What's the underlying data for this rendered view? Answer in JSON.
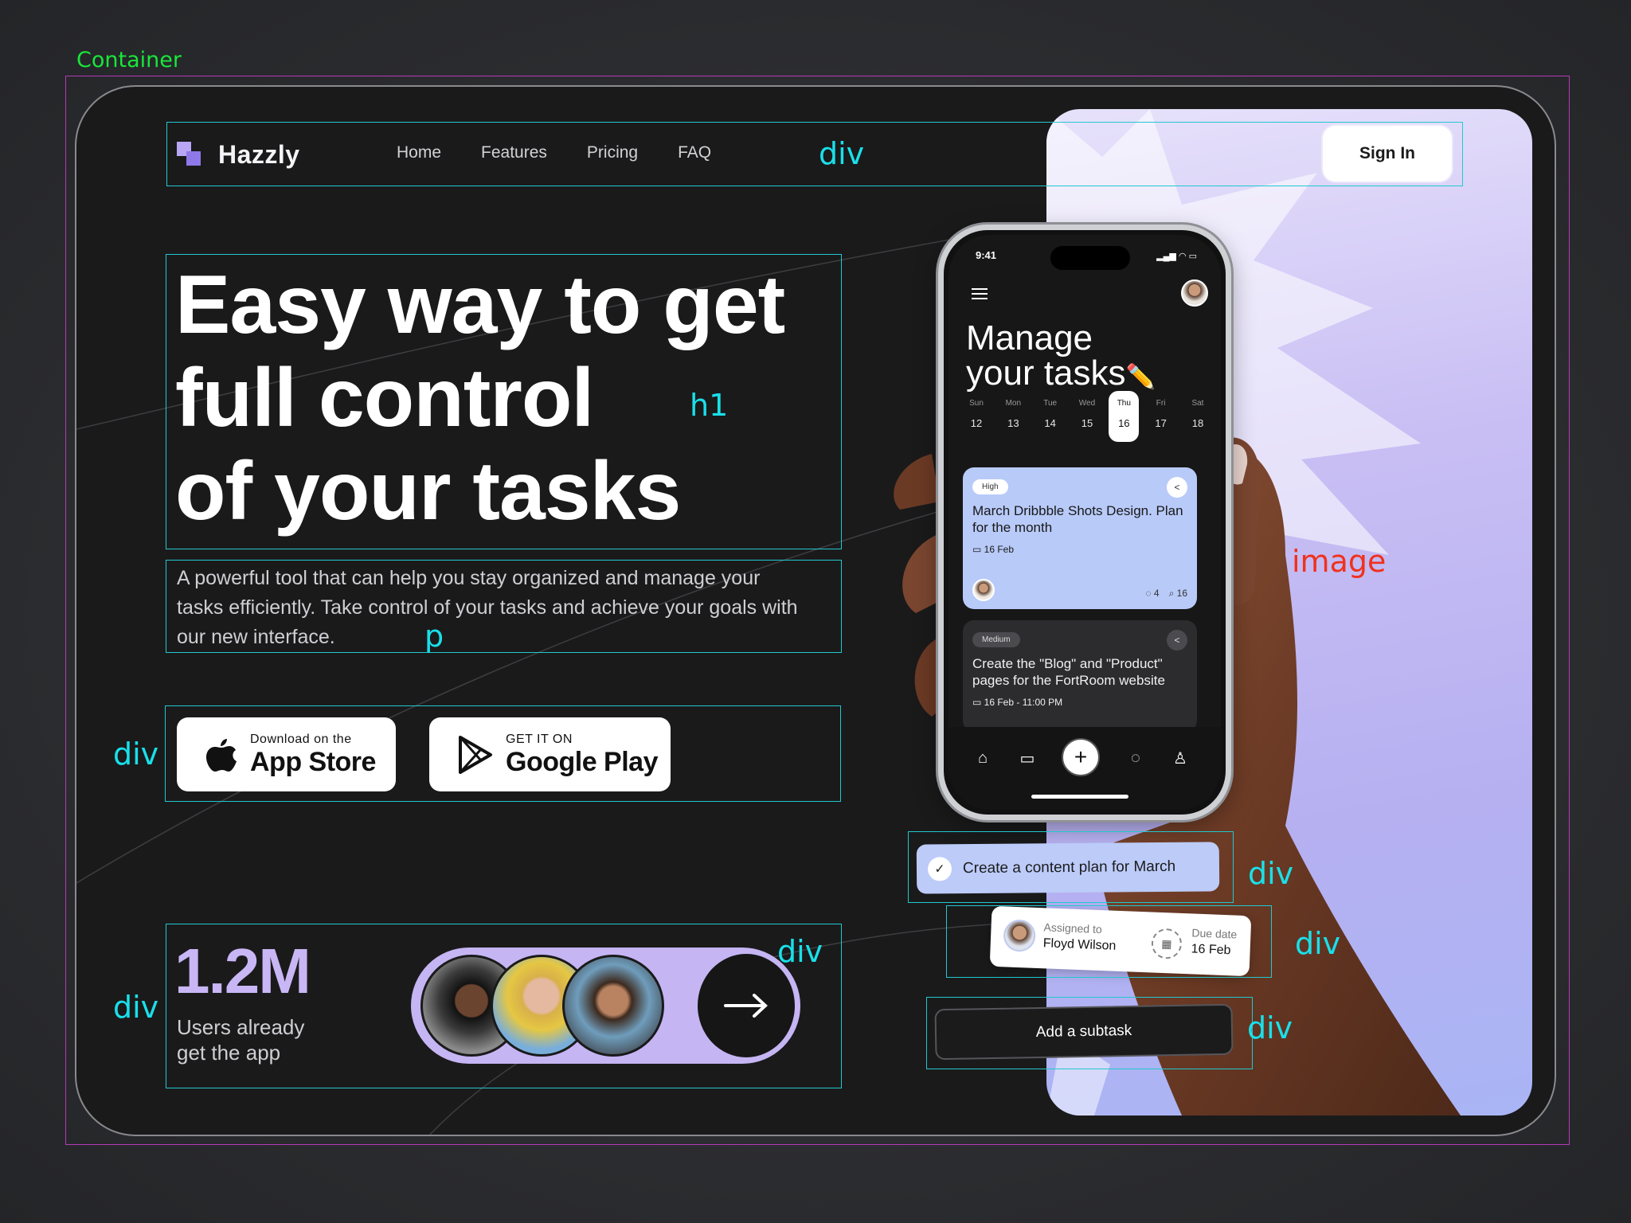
{
  "annotations": {
    "container": "Container",
    "nav_div": "div",
    "h1": "h1",
    "p": "p",
    "buttons_div": "div",
    "stats_div": "div",
    "stats_inner_div": "div",
    "image": "image",
    "content_plan_div": "div",
    "assign_div": "div",
    "subtask_div": "div"
  },
  "brand": {
    "name": "Hazzly"
  },
  "nav": {
    "links": [
      "Home",
      "Features",
      "Pricing",
      "FAQ"
    ],
    "signin": "Sign In"
  },
  "hero": {
    "headline_lines": [
      "Easy way to get",
      "full control",
      "of your tasks"
    ],
    "subtitle": "A powerful tool that can help you stay organized and manage your tasks efficiently. Take control of your tasks and achieve your goals with our new interface."
  },
  "stores": {
    "apple": {
      "small": "Download on the",
      "big": "App Store",
      "icon": "apple-icon"
    },
    "google": {
      "small": "GET IT ON",
      "big": "Google Play",
      "icon": "google-play-icon"
    }
  },
  "stats": {
    "value": "1.2M",
    "label": "Users already get the app"
  },
  "phone": {
    "time": "9:41",
    "title_line1": "Manage",
    "title_line2": "your tasks",
    "title_emoji": "✏️",
    "week": [
      {
        "name": "Sun",
        "date": "12",
        "active": false
      },
      {
        "name": "Mon",
        "date": "13",
        "active": false
      },
      {
        "name": "Tue",
        "date": "14",
        "active": false
      },
      {
        "name": "Wed",
        "date": "15",
        "active": false
      },
      {
        "name": "Thu",
        "date": "16",
        "active": true
      },
      {
        "name": "Fri",
        "date": "17",
        "active": false
      },
      {
        "name": "Sat",
        "date": "18",
        "active": false
      }
    ],
    "tasks": [
      {
        "priority": "High",
        "title": "March Dribbble Shots Design. Plan for the month",
        "date": "16 Feb",
        "comments": "4",
        "attachments": "16"
      },
      {
        "priority": "Medium",
        "title": "Create the \"Blog\" and \"Product\" pages for the FortRoom website",
        "date": "16 Feb - 11:00 PM"
      }
    ]
  },
  "widgets": {
    "content_plan": "Create a content plan for March",
    "assigned_label": "Assigned to",
    "assigned_name": "Floyd Wilson",
    "due_label": "Due date",
    "due_value": "16 Feb",
    "subtask": "Add a subtask"
  },
  "colors": {
    "accent": "#c8b6f5",
    "card": "#1a1a1b",
    "task_blue": "#b8caf8",
    "annotation": "#22c8cf"
  }
}
